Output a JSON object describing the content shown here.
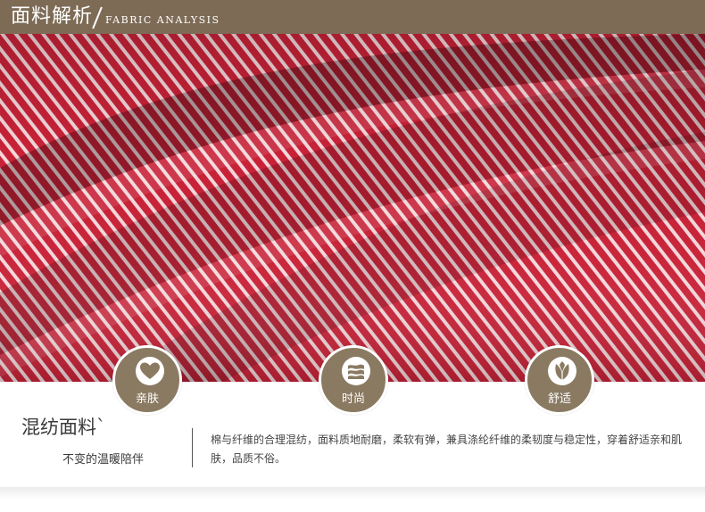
{
  "header": {
    "title": "面料解析",
    "subtitle": "FABRIC ANALYSIS"
  },
  "colors": {
    "header_bg": "#7d6b56",
    "fabric_red": "#c9253a",
    "stripe_white": "#f2d9dc",
    "badge_bg": "#8b7a62"
  },
  "features": [
    {
      "label": "亲肤",
      "icon": "heart-icon"
    },
    {
      "label": "时尚",
      "icon": "fabric-stack-icon"
    },
    {
      "label": "舒适",
      "icon": "leaf-icon"
    }
  ],
  "info": {
    "title": "混纺面料`",
    "tagline": "不变的温暖陪伴",
    "description": "棉与纤维的合理混纺，面料质地耐磨，柔软有弹，兼具涤纶纤维的柔韧度与稳定性，穿着舒适亲和肌肤，品质不俗。"
  }
}
